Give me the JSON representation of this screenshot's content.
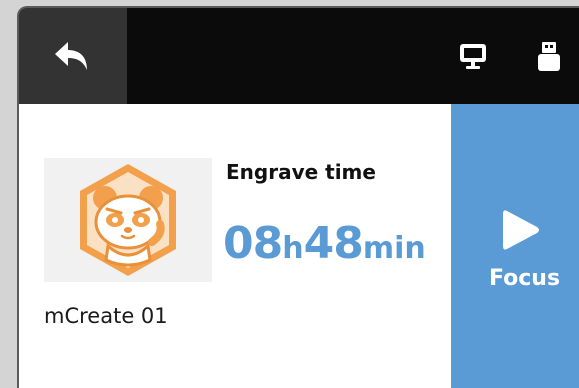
{
  "topbar": {
    "back_icon": "back-arrow-icon",
    "monitor_icon": "monitor-icon",
    "usb_icon": "usb-drive-icon"
  },
  "job": {
    "thumbnail_icon": "panda-logo",
    "filename": "mCreate 01",
    "engrave_label": "Engrave time",
    "hours": "08",
    "hours_unit": "h",
    "minutes": "48",
    "minutes_unit": "min"
  },
  "focus": {
    "label": "Focus",
    "icon": "play-icon"
  },
  "colors": {
    "accent": "#5b9bd5",
    "topbar": "#0b0b0b",
    "back_button": "#333333",
    "logo_orange": "#f2a04b"
  }
}
